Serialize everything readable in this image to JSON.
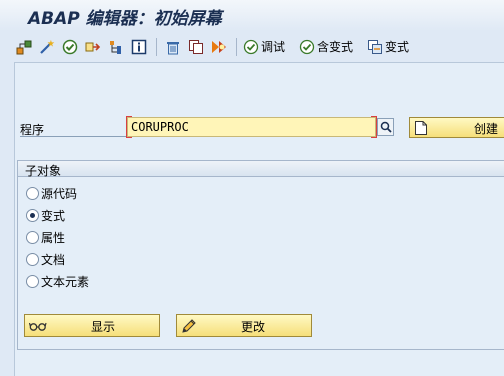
{
  "window": {
    "title": "ABAP 编辑器：初始屏幕"
  },
  "toolbar": {
    "icons": [
      "hierarchy-icon",
      "magic-wand-icon",
      "activate-icon",
      "where-used-icon",
      "tree-icon",
      "info-icon",
      "delete-icon",
      "copy-icon",
      "execute-icon"
    ],
    "debug_label": "调试",
    "with_variant_label": "含变式",
    "variant_label": "变式"
  },
  "program": {
    "label": "程序",
    "value": "CORUPROC",
    "create_label": "创建"
  },
  "subobjects": {
    "title": "子对象",
    "options": [
      {
        "label": "源代码",
        "selected": false
      },
      {
        "label": "变式",
        "selected": true
      },
      {
        "label": "属性",
        "selected": false
      },
      {
        "label": "文档",
        "selected": false
      },
      {
        "label": "文本元素",
        "selected": false
      }
    ]
  },
  "actions": {
    "display_label": "显示",
    "change_label": "更改"
  },
  "colors": {
    "background": "#dfe9f5",
    "input_fill": "#fff5b8",
    "button_fill": "#f6df7a",
    "required_marker": "#d84040"
  }
}
